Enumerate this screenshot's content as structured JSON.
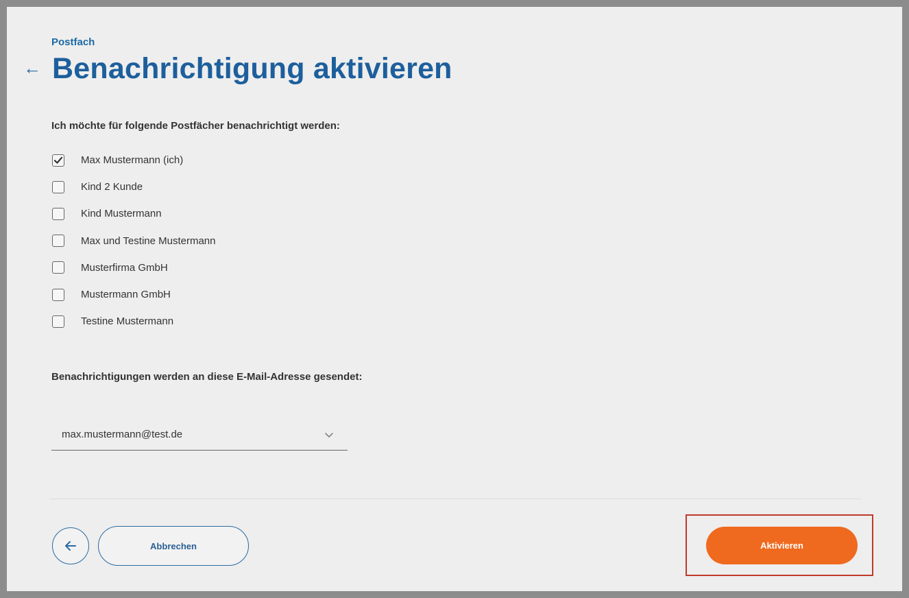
{
  "header": {
    "breadcrumb": "Postfach",
    "title": "Benachrichtigung aktivieren",
    "back_icon": "arrow-left-icon"
  },
  "mailboxes": {
    "label": "Ich möchte für folgende Postfächer benachrichtigt werden:",
    "items": [
      {
        "label": "Max Mustermann (ich)",
        "checked": true
      },
      {
        "label": "Kind 2 Kunde",
        "checked": false
      },
      {
        "label": "Kind Mustermann",
        "checked": false
      },
      {
        "label": "Max und Testine Mustermann",
        "checked": false
      },
      {
        "label": "Musterfirma GmbH",
        "checked": false
      },
      {
        "label": "Mustermann GmbH",
        "checked": false
      },
      {
        "label": "Testine Mustermann",
        "checked": false
      }
    ]
  },
  "email": {
    "label": "Benachrichtigungen werden an diese E-Mail-Adresse gesendet:",
    "selected": "max.mustermann@test.de",
    "icon": "chevron-down-icon"
  },
  "footer": {
    "back_icon": "arrow-left-icon",
    "cancel_label": "Abbrechen",
    "activate_label": "Aktivieren"
  },
  "colors": {
    "primary_blue": "#1d5f9c",
    "accent_orange": "#ef6a1e",
    "highlight_red": "#c0392b",
    "background": "#eeeeee"
  }
}
